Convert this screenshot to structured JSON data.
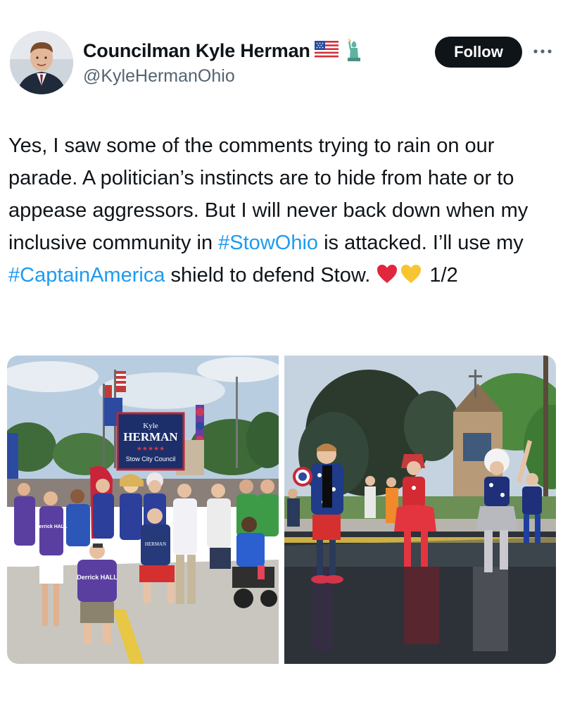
{
  "author": {
    "display_name": "Councilman Kyle Herman",
    "handle": "@KyleHermanOhio",
    "name_emojis": [
      "us-flag-icon",
      "statue-of-liberty-icon"
    ]
  },
  "actions": {
    "follow_label": "Follow",
    "more_label": "···"
  },
  "tweet": {
    "segments": [
      "Yes, I saw some of the comments trying to rain on our parade. A politician’s instincts are to hide from hate or to appease aggressors. But I will never back down when my inclusive community in ",
      "#StowOhio",
      " is attacked. I’ll use my ",
      "#CaptainAmerica",
      " shield to defend Stow. ",
      " 1/2"
    ],
    "hashtags": [
      "#StowOhio",
      "#CaptainAmerica"
    ],
    "thread_counter": "1/2"
  },
  "media": {
    "left_photo": {
      "sign_line1": "Kyle",
      "sign_line2": "HERMAN",
      "sign_stars": "★★★★★",
      "sign_line3": "Stow City Council",
      "shirt_text1": "Derrick HALL",
      "shirt_text2": "Derrick HALL"
    },
    "right_photo": {}
  },
  "colors": {
    "hashtag": "#1d9bf0",
    "follow_bg": "#0f1419",
    "text": "#0f1419",
    "handle": "#536471"
  }
}
